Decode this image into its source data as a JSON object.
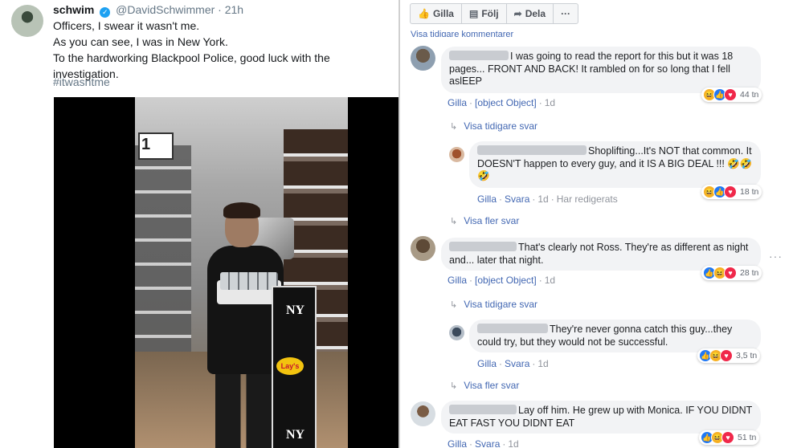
{
  "tweet": {
    "name": "schwim",
    "verified_mark": "✓",
    "handle": "@DavidSchwimmer",
    "separator": "·",
    "time": "21h",
    "lines": [
      "Officers, I swear it wasn't me.",
      "As you can see, I was in New York.",
      "To the hardworking Blackpool Police, good luck with the investigation."
    ],
    "hashtag": "#itwasntme",
    "video": {
      "sign_number": "1",
      "logo_ny": "NY",
      "logo_lays": "Lay's"
    }
  },
  "fb": {
    "actions": [
      {
        "icon": "thumbs-up-icon",
        "glyph": "👍",
        "label": "Gilla"
      },
      {
        "icon": "follow-icon",
        "glyph": "▤",
        "label": "Följ"
      },
      {
        "icon": "share-icon",
        "glyph": "➦",
        "label": "Dela"
      },
      {
        "icon": "more-icon",
        "glyph": "",
        "label": "···"
      }
    ],
    "view_previous_comments": "Visa tidigare kommentarer",
    "comments": [
      {
        "text": "I was going to read the report for this but it was 18 pages... FRONT AND BACK! It rambled on for so long that I fell aslEEP",
        "reactions": [
          "haha",
          "like",
          "love"
        ],
        "count": "44 tn",
        "like": "Gilla",
        "reply": {
          "text": "Shoplifting...It's NOT that common. It DOESN'T happen to every guy, and it IS A BIG DEAL !!! 🤣🤣🤣",
          "reactions": [
            "haha",
            "like",
            "love"
          ],
          "count": "18 tn",
          "like": "Gilla",
          "reply": "Svara",
          "age": "1d",
          "edited": "Har redigerats"
        },
        "age": "1d",
        "replies_link": "Visa tidigare svar",
        "more_link": "Visa fler svar"
      },
      {
        "text": "That's clearly not Ross. They're as different as night and... later that night.",
        "reactions": [
          "like",
          "haha",
          "love"
        ],
        "count": "28 tn",
        "like": "Gilla",
        "reply": {
          "text": "They're never gonna catch this guy...they could try, but they would not be successful.",
          "reactions": [
            "like",
            "haha",
            "love"
          ],
          "count": "3,5 tn",
          "like": "Gilla",
          "reply": "Svara",
          "age": "1d"
        },
        "age": "1d",
        "replies_link": "Visa tidigare svar",
        "more_link": "Visa fler svar"
      },
      {
        "text": "Lay off him. He grew up with Monica. IF YOU DIDNT EAT FAST YOU DIDNT EAT",
        "reactions": [
          "like",
          "haha",
          "love"
        ],
        "count": "51 tn",
        "like": "Gilla",
        "reply": "Svara",
        "age": "1d"
      }
    ],
    "more_options": "···"
  }
}
